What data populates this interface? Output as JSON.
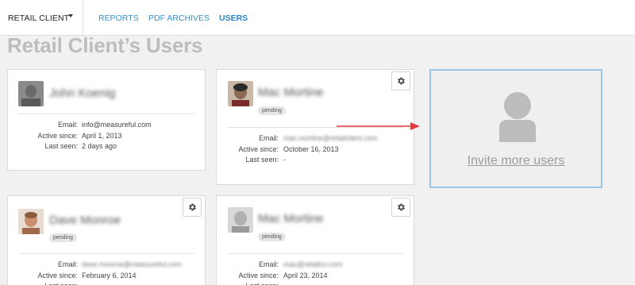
{
  "nav": {
    "client": "RETAIL CLIENT",
    "items": [
      {
        "label": "REPORTS",
        "active": false
      },
      {
        "label": "PDF ARCHIVES",
        "active": false
      },
      {
        "label": "USERS",
        "active": true
      }
    ]
  },
  "page": {
    "title": "Retail Client’s Users"
  },
  "field_labels": {
    "email": "Email:",
    "active_since": "Active since:",
    "last_seen": "Last seen:"
  },
  "users": [
    {
      "name": "John Koenig",
      "status": "",
      "email": "info@measureful.com",
      "email_obscured": false,
      "active_since": "April 1, 2013",
      "last_seen": "2 days ago",
      "has_settings": false
    },
    {
      "name": "Mac Mortine",
      "status": "pending",
      "email": "mac.mortine@retailclient.com",
      "email_obscured": true,
      "active_since": "October 16, 2013",
      "last_seen": "-",
      "has_settings": true
    },
    {
      "name": "Dave Monroe",
      "status": "pending",
      "email": "dave.monroe@measureful.com",
      "email_obscured": true,
      "active_since": "February 6, 2014",
      "last_seen": "",
      "has_settings": true
    },
    {
      "name": "Mac Mortine",
      "status": "pending",
      "email": "mac@retailco.com",
      "email_obscured": true,
      "active_since": "April 23, 2014",
      "last_seen": "",
      "has_settings": true
    }
  ],
  "invite": {
    "label": "Invite more users"
  },
  "colors": {
    "link": "#3a8fc8",
    "invite_border": "#9ec4e4",
    "arrow": "#e23b3b",
    "title": "#bdbdbd"
  },
  "icons": {
    "settings": "gear-icon",
    "invite": "user-silhouette-icon",
    "dropdown": "caret-down-icon"
  }
}
